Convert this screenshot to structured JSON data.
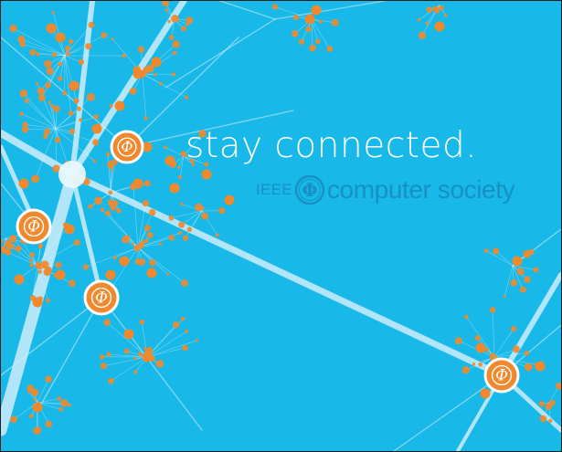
{
  "ad": {
    "tagline": "stay connected.",
    "logo": {
      "prefix": "IEEE",
      "name": "computer society",
      "mark_glyph": "Φ"
    }
  },
  "colors": {
    "background": "#18b8e8",
    "node": "#f0892e",
    "node_ring": "#ffffff",
    "link": "#d8f1fb",
    "hub": "#e8f7fd",
    "text": "#ffffff",
    "logo": "#1591c3",
    "border": "#1d1d1b"
  },
  "icons": {
    "hub_node": "phi-badge-icon",
    "logo_mark": "phi-seal-icon"
  }
}
